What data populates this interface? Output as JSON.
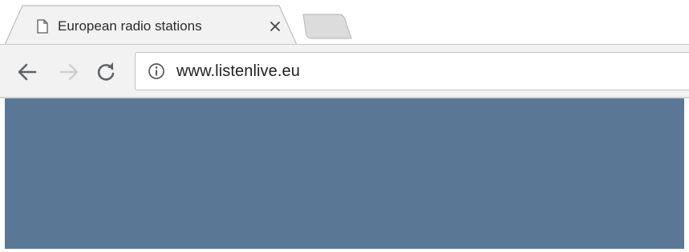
{
  "browser": {
    "tab": {
      "title": "European radio stations",
      "icon": "page-icon",
      "close_icon": "close-icon"
    },
    "new_tab_icon": "new-tab-icon",
    "nav": {
      "back_icon": "back-arrow-icon",
      "forward_icon": "forward-arrow-icon",
      "reload_icon": "reload-icon"
    },
    "address_bar": {
      "security_icon": "info-icon",
      "url": "www.listenlive.eu"
    }
  },
  "page": {
    "background_color": "#5a7896"
  }
}
